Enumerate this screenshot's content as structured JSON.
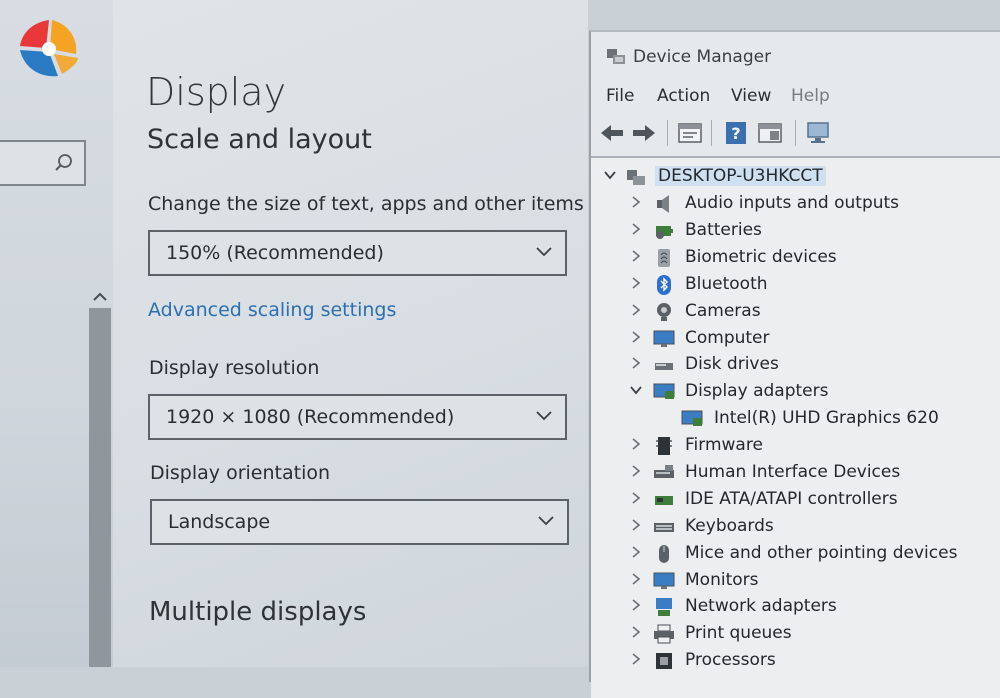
{
  "settings": {
    "page_title": "Display",
    "section_title": "Scale and layout",
    "scale_label": "Change the size of text, apps and other items",
    "scale_value": "150% (Recommended)",
    "advanced_link": "Advanced scaling settings",
    "resolution_label": "Display resolution",
    "resolution_value": "1920 × 1080 (Recommended)",
    "orientation_label": "Display orientation",
    "orientation_value": "Landscape",
    "multiple_displays": "Multiple displays"
  },
  "device_manager": {
    "title": "Device Manager",
    "menu": [
      "File",
      "Action",
      "View",
      "Help"
    ],
    "toolbar_icons": [
      "back-arrow-icon",
      "forward-arrow-icon",
      "properties-icon",
      "help-icon",
      "view-icon",
      "monitor-scan-icon"
    ],
    "root": "DESKTOP-U3HKCCT",
    "categories": [
      {
        "label": "Audio inputs and outputs",
        "icon": "speaker-icon",
        "expanded": false
      },
      {
        "label": "Batteries",
        "icon": "battery-icon",
        "expanded": false
      },
      {
        "label": "Biometric devices",
        "icon": "fingerprint-icon",
        "expanded": false
      },
      {
        "label": "Bluetooth",
        "icon": "bluetooth-icon",
        "expanded": false
      },
      {
        "label": "Cameras",
        "icon": "camera-icon",
        "expanded": false
      },
      {
        "label": "Computer",
        "icon": "computer-icon",
        "expanded": false
      },
      {
        "label": "Disk drives",
        "icon": "disk-drive-icon",
        "expanded": false
      },
      {
        "label": "Display adapters",
        "icon": "display-adapter-icon",
        "expanded": true
      },
      {
        "label": "Intel(R) UHD Graphics 620",
        "icon": "display-adapter-icon",
        "child": true
      },
      {
        "label": "Firmware",
        "icon": "firmware-icon",
        "expanded": false
      },
      {
        "label": "Human Interface Devices",
        "icon": "hid-icon",
        "expanded": false
      },
      {
        "label": "IDE ATA/ATAPI controllers",
        "icon": "ide-controller-icon",
        "expanded": false
      },
      {
        "label": "Keyboards",
        "icon": "keyboard-icon",
        "expanded": false
      },
      {
        "label": "Mice and other pointing devices",
        "icon": "mouse-icon",
        "expanded": false
      },
      {
        "label": "Monitors",
        "icon": "monitor-icon",
        "expanded": false
      },
      {
        "label": "Network adapters",
        "icon": "network-adapter-icon",
        "expanded": false
      },
      {
        "label": "Print queues",
        "icon": "printer-icon",
        "expanded": false
      },
      {
        "label": "Processors",
        "icon": "processor-icon",
        "expanded": false
      }
    ]
  },
  "colors": {
    "link": "#2c6fb3",
    "logo_red": "#e8383a",
    "logo_orange": "#f5a323",
    "logo_blue": "#2b7bc4"
  }
}
